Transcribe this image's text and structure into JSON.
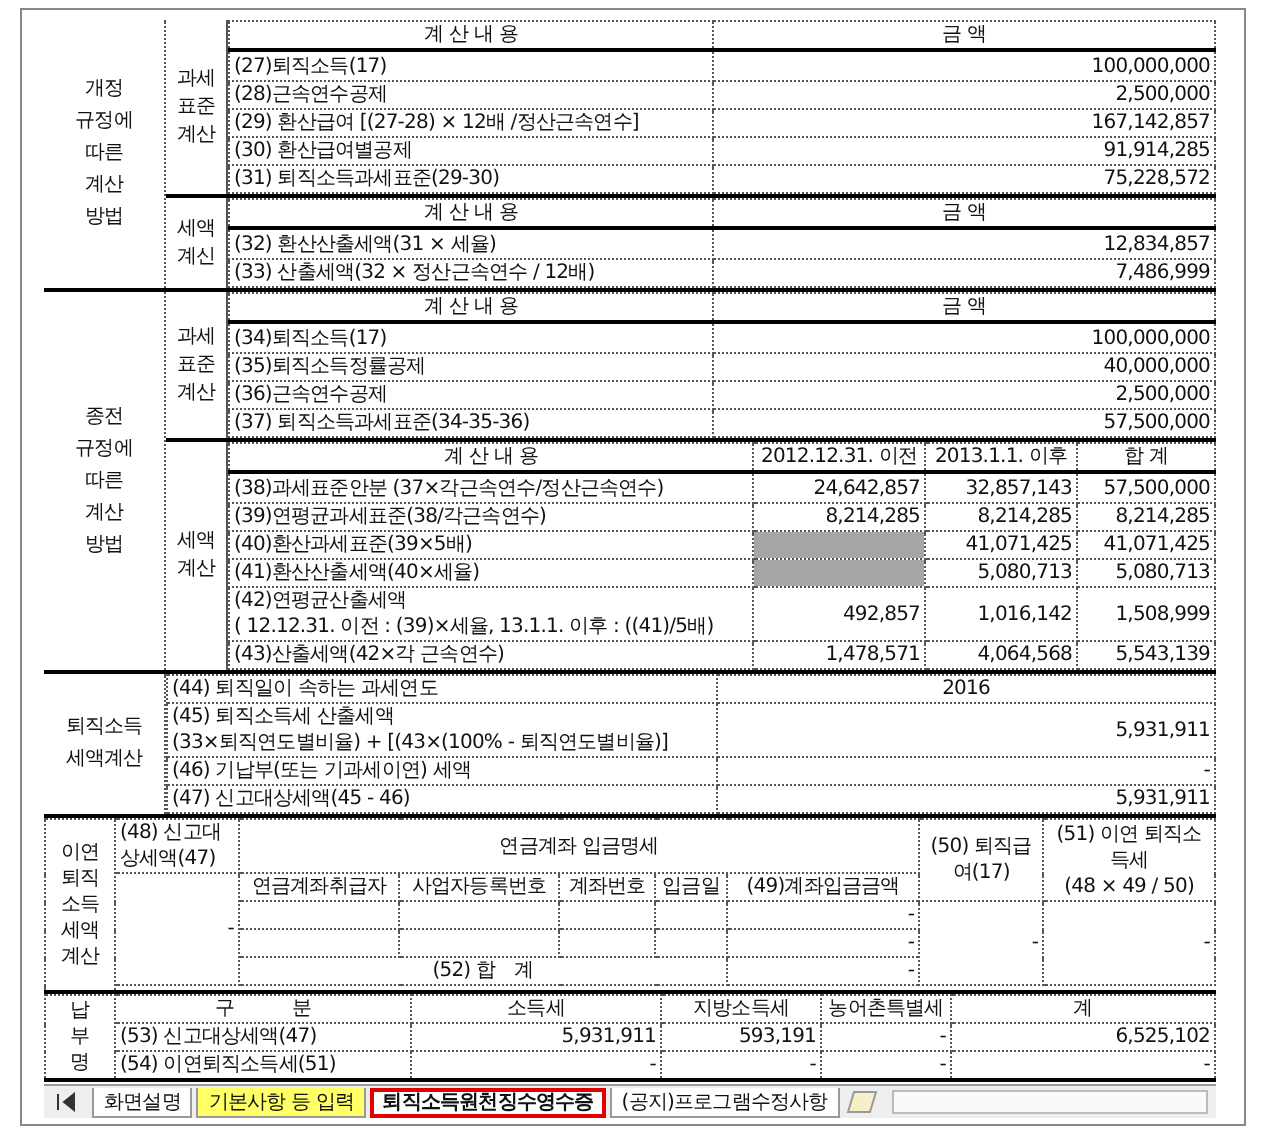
{
  "revised": {
    "label": "개정\n규정에\n따른\n계산\n방법",
    "blocks": [
      {
        "label": "과세\n표준\n계산",
        "headers": [
          "계 산 내 용",
          "금 액"
        ],
        "rows": [
          {
            "item": "(27)퇴직소득(17)",
            "amount": "100,000,000"
          },
          {
            "item": "(28)근속연수공제",
            "amount": "2,500,000"
          },
          {
            "item": "(29) 환산급여 [(27-28) × 12배 /정산근속연수]",
            "amount": "167,142,857"
          },
          {
            "item": "(30) 환산급여별공제",
            "amount": "91,914,285"
          },
          {
            "item": "(31) 퇴직소득과세표준(29-30)",
            "amount": "75,228,572"
          }
        ]
      },
      {
        "label": "세액\n계신",
        "headers": [
          "계 산 내 용",
          "금 액"
        ],
        "rows": [
          {
            "item": "(32) 환산산출세액(31 × 세율)",
            "amount": "12,834,857"
          },
          {
            "item": "(33) 산출세액(32 × 정산근속연수 / 12배)",
            "amount": "7,486,999"
          }
        ]
      }
    ]
  },
  "previous": {
    "label": "종전\n규정에\n따른\n계산\n방법",
    "base": {
      "label": "과세\n표준\n계산",
      "headers": [
        "계 산 내 용",
        "금 액"
      ],
      "rows": [
        {
          "item": "(34)퇴직소득(17)",
          "amount": "100,000,000"
        },
        {
          "item": "(35)퇴직소득정률공제",
          "amount": "40,000,000"
        },
        {
          "item": "(36)근속연수공제",
          "amount": "2,500,000"
        },
        {
          "item": "(37) 퇴직소득과세표준(34-35-36)",
          "amount": "57,500,000"
        }
      ]
    },
    "tax": {
      "label": "세액\n계산",
      "headers": [
        "계 산 내 용",
        "2012.12.31. 이전",
        "2013.1.1. 이후",
        "합 계"
      ],
      "rows": [
        {
          "item": "(38)과세표준안분 (37×각근속연수/정산근속연수)",
          "blocked": false,
          "values": [
            "24,642,857",
            "32,857,143",
            "57,500,000"
          ]
        },
        {
          "item": "(39)연평균과세표준(38/각근속연수)",
          "blocked": false,
          "values": [
            "8,214,285",
            "8,214,285",
            "8,214,285"
          ]
        },
        {
          "item": "(40)환산과세표준(39×5배)",
          "blocked": true,
          "values": [
            "41,071,425",
            "41,071,425"
          ]
        },
        {
          "item": "(41)환산산출세액(40×세율)",
          "blocked": true,
          "values": [
            "5,080,713",
            "5,080,713"
          ]
        },
        {
          "item": "(42)연평균산출세액\n( 12.12.31. 이전 : (39)×세율, 13.1.1. 이후 : ((41)/5배)",
          "blocked": false,
          "values": [
            "492,857",
            "1,016,142",
            "1,508,999"
          ]
        },
        {
          "item": "(43)산출세액(42×각 근속연수)",
          "blocked": false,
          "values": [
            "1,478,571",
            "4,064,568",
            "5,543,139"
          ]
        }
      ]
    }
  },
  "retirement_tax": {
    "label": "퇴직소득\n세액계산",
    "rows": [
      {
        "kind": "year",
        "item": "(44) 퇴직일이 속하는 과세연도",
        "value": "2016"
      },
      {
        "kind": "amount",
        "item": "(45) 퇴직소득세 산출세액\n(33×퇴직연도별비율) + [(43×(100% - 퇴직연도별비율)]",
        "value": "5,931,911"
      },
      {
        "kind": "amount",
        "item": "(46) 기납부(또는 기과세이연) 세액",
        "value": "-"
      },
      {
        "kind": "amount",
        "item": "(47) 신고대상세액(45 - 46)",
        "value": "5,931,911"
      }
    ]
  },
  "deferred": {
    "label": "이연\n퇴직\n소득\n세액\n계산",
    "reported_tax": {
      "header": "(48) 신고대상세액(47)",
      "value": "-"
    },
    "pension_header": "연금계좌 입금명세",
    "pension_columns": [
      "연금계좌취급자",
      "사업자등록번호",
      "계좌번호",
      "입금일",
      "(49)계좌입금금액"
    ],
    "pension_rows": [
      [
        "",
        "",
        "",
        "",
        "-"
      ],
      [
        "",
        "",
        "",
        "",
        "-"
      ]
    ],
    "total": {
      "label": "(52) 합　계",
      "value": "-"
    },
    "retirement_pay": {
      "header": "(50) 퇴직급여(17)",
      "value": "-"
    },
    "deferred_tax": {
      "header": "(51) 이연 퇴직소득세\n(48 × 49 / 50)",
      "value": "-"
    }
  },
  "payment": {
    "label": "납\n부\n명",
    "columns": [
      "구　　　분",
      "소득세",
      "지방소득세",
      "농어촌특별세",
      "계"
    ],
    "rows": [
      [
        "(53) 신고대상세액(47)",
        "5,931,911",
        "593,191",
        "-",
        "6,525,102"
      ],
      [
        "(54) 이연퇴직소득세(51)",
        "-",
        "-",
        "-",
        "-"
      ]
    ]
  },
  "sheet_tabs": [
    {
      "label": "화면설명",
      "selected": false,
      "color": "#ffffff"
    },
    {
      "label": "기본사항 등 입력",
      "selected": false,
      "color": "#ffff66"
    },
    {
      "label": "퇴직소득원천징수영수증",
      "selected": true,
      "color": "#ffffff"
    },
    {
      "label": "(공지)프로그램수정사항",
      "selected": false,
      "color": "#ffffff"
    }
  ]
}
